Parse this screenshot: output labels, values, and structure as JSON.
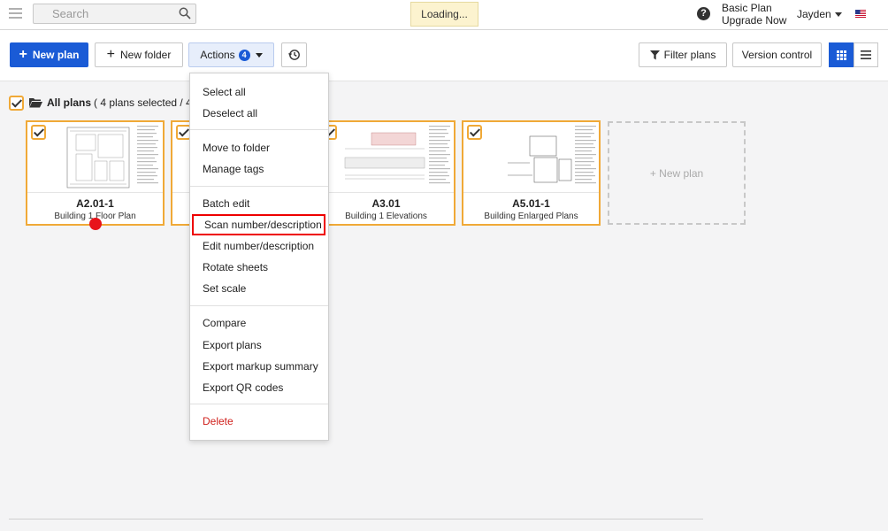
{
  "topbar": {
    "search_placeholder": "Search",
    "loading_text": "Loading...",
    "plan_name": "Basic Plan",
    "upgrade_link": "Upgrade Now",
    "user_name": "Jayden"
  },
  "toolbar": {
    "new_plan": "New plan",
    "new_folder": "New folder",
    "actions": "Actions",
    "actions_count": "4",
    "filter_plans": "Filter plans",
    "version_control": "Version control"
  },
  "breadcrumb": {
    "title": "All plans",
    "selection_info": "( 4 plans selected / 4 pl"
  },
  "plans": [
    {
      "number": "A2.01-1",
      "description": "Building 1 Floor Plan"
    },
    {
      "number": "",
      "description": ""
    },
    {
      "number": "A3.01",
      "description": "Building 1 Elevations"
    },
    {
      "number": "A5.01-1",
      "description": "Building Enlarged Plans"
    }
  ],
  "new_plan_card": "+ New plan",
  "menu": {
    "select_all": "Select all",
    "deselect_all": "Deselect all",
    "move_to_folder": "Move to folder",
    "manage_tags": "Manage tags",
    "batch_edit": "Batch edit",
    "scan_number": "Scan number/description",
    "edit_number": "Edit number/description",
    "rotate_sheets": "Rotate sheets",
    "set_scale": "Set scale",
    "compare": "Compare",
    "export_plans": "Export plans",
    "export_markup": "Export markup summary",
    "export_qr": "Export QR codes",
    "delete": "Delete"
  },
  "colors": {
    "primary": "#1a5bd6",
    "selection": "#f0a937",
    "danger": "#d0201c",
    "highlight_box": "#e00000"
  }
}
